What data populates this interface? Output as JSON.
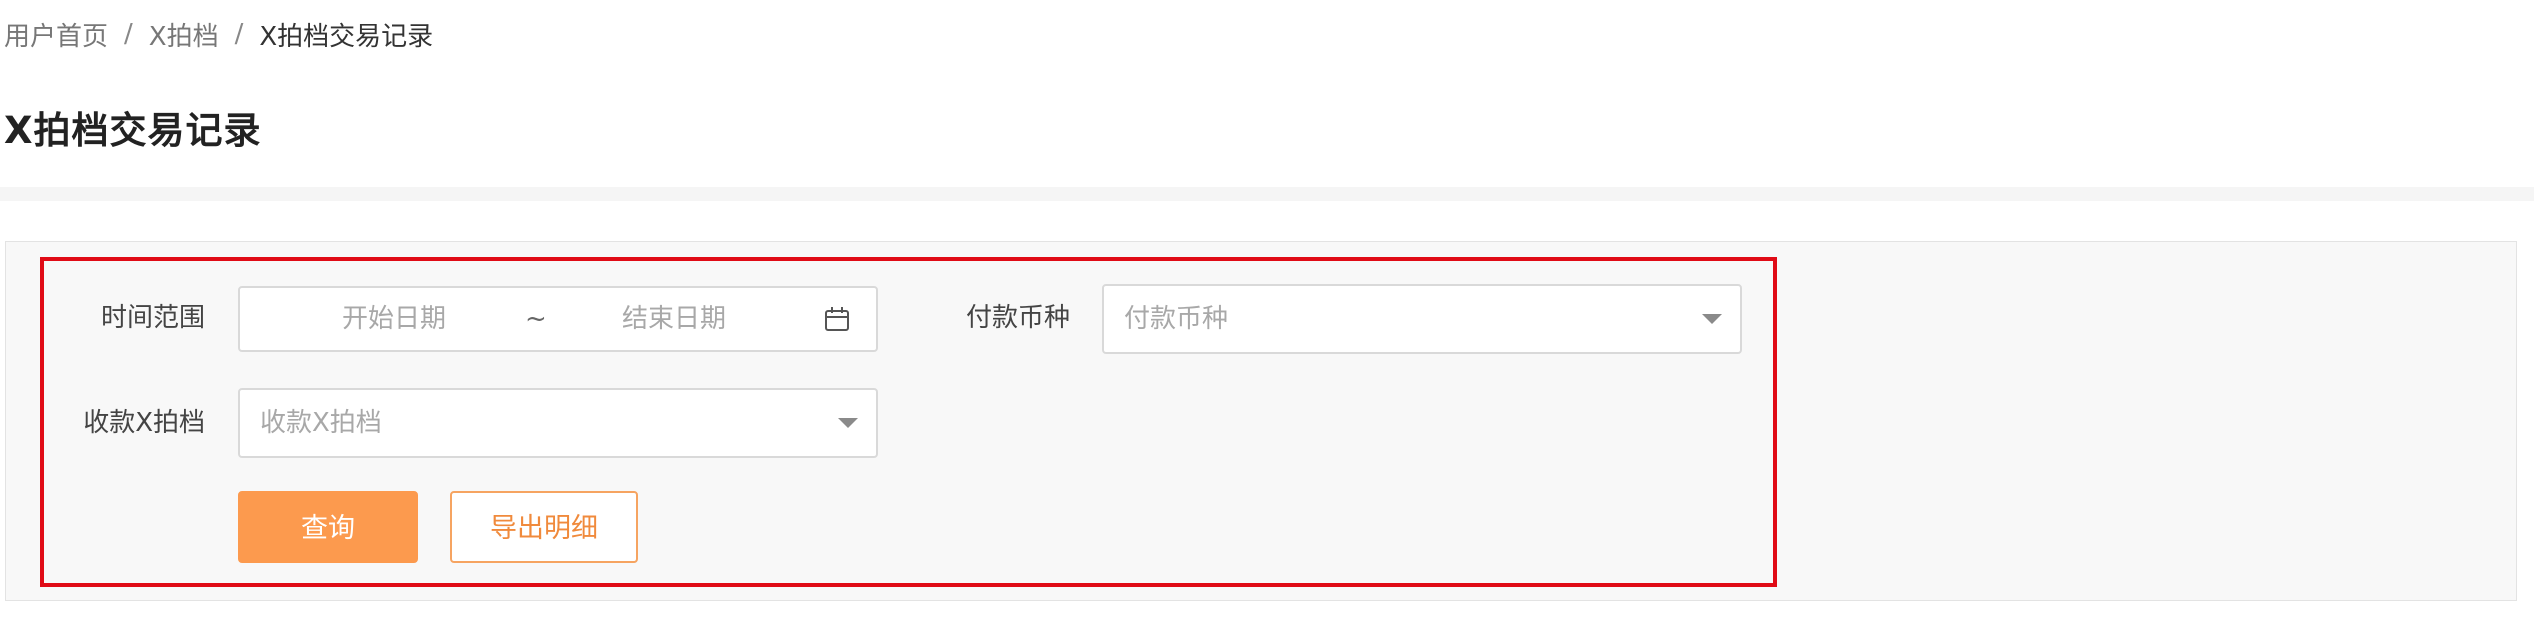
{
  "breadcrumb": {
    "items": [
      "用户首页",
      "X拍档",
      "X拍档交易记录"
    ],
    "separator": "/"
  },
  "page": {
    "title": "X拍档交易记录"
  },
  "filters": {
    "time_range": {
      "label": "时间范围",
      "start_placeholder": "开始日期",
      "tilde": "~",
      "end_placeholder": "结束日期",
      "icon": "calendar-icon"
    },
    "currency": {
      "label": "付款币种",
      "placeholder": "付款币种",
      "icon": "caret-down-icon"
    },
    "partner": {
      "label": "收款X拍档",
      "placeholder": "收款X拍档",
      "icon": "caret-down-icon"
    }
  },
  "actions": {
    "query_label": "查询",
    "export_label": "导出明细"
  },
  "colors": {
    "primary": "#fc9a4e",
    "outline_text": "#f08a3c",
    "highlight": "#e00b16",
    "panel_bg": "#f8f8f8"
  }
}
